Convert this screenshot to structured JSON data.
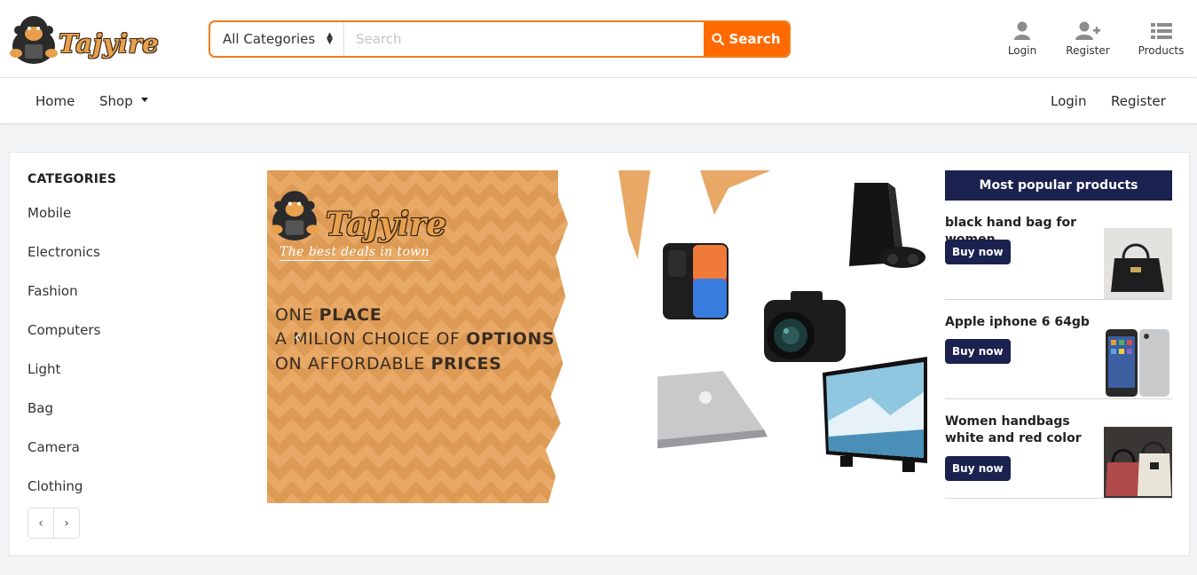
{
  "header": {
    "brand": "Tajyire",
    "search": {
      "category_selected": "All Categories",
      "placeholder": "Search",
      "button_label": "Search"
    },
    "icons": [
      {
        "label": "Login",
        "icon": "user-icon"
      },
      {
        "label": "Register",
        "icon": "user-plus-icon"
      },
      {
        "label": "Products",
        "icon": "list-icon"
      }
    ]
  },
  "nav": {
    "home": "Home",
    "shop": "Shop",
    "login": "Login",
    "register": "Register"
  },
  "categories": {
    "title": "CATEGORIES",
    "items": [
      "Mobile",
      "Electronics",
      "Fashion",
      "Computers",
      "Light",
      "Bag",
      "Camera",
      "Clothing"
    ],
    "prev": "‹",
    "next": "›"
  },
  "banner": {
    "brand": "Tajyire",
    "tagline": "The best deals in town",
    "line1_a": "ONE ",
    "line1_b": "PLACE",
    "line2_a": "A MILION CHOICE OF ",
    "line2_b": "OPTIONS",
    "line3_a": "ON AFFORDABLE ",
    "line3_b": "PRICES",
    "colors": {
      "background": "#e8a866",
      "text": "#3a2d22"
    }
  },
  "popular": {
    "title": "Most popular products",
    "items": [
      {
        "name": "black hand bag for women",
        "button": "Buy now"
      },
      {
        "name": "Apple iphone 6 64gb",
        "button": "Buy now"
      },
      {
        "name": "Women handbags white and red color",
        "button": "Buy now"
      }
    ]
  },
  "colors": {
    "accent": "#ff6a00",
    "navy": "#1b2250"
  }
}
